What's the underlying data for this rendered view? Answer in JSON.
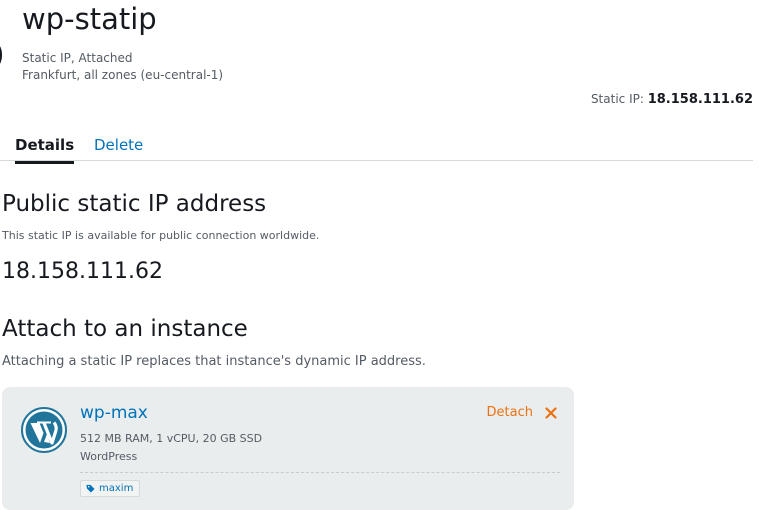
{
  "header": {
    "title": "wp-statip",
    "status": "Static IP, Attached",
    "location": "Frankfurt, all zones (eu-central-1)",
    "static_ip_label": "Static IP:",
    "static_ip_value": "18.158.111.62"
  },
  "tabs": [
    {
      "label": "Details",
      "active": true
    },
    {
      "label": "Delete",
      "active": false
    }
  ],
  "public_ip": {
    "heading": "Public static IP address",
    "description": "This static IP is available for public connection worldwide.",
    "ip": "18.158.111.62"
  },
  "attach": {
    "heading": "Attach to an instance",
    "description": "Attaching a static IP replaces that instance's dynamic IP address.",
    "instance": {
      "name": "wp-max",
      "specs": "512 MB RAM, 1 vCPU, 20 GB SSD",
      "blueprint": "WordPress",
      "tag": "maxim",
      "detach_label": "Detach",
      "icon": "wordpress-icon"
    }
  },
  "colors": {
    "link": "#0073bb",
    "accent": "#ec7211",
    "text": "#16191f",
    "muted": "#545b64",
    "card_bg": "#eaeded"
  }
}
